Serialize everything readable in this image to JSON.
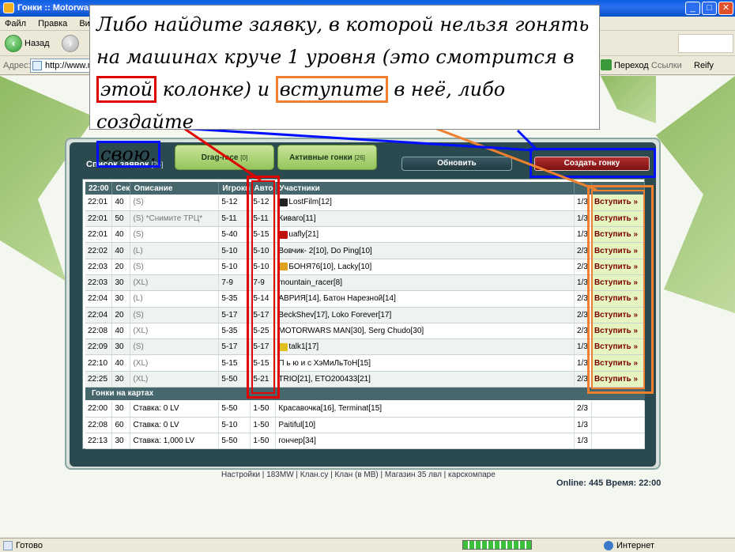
{
  "window": {
    "title": "Гонки :: Motorwar"
  },
  "menu": [
    "Файл",
    "Правка",
    "Вид"
  ],
  "toolbar": {
    "back_label": "Назад",
    "go_label": "Переход",
    "links_label": "Ссылки",
    "reify_label": "Reify"
  },
  "address": {
    "label": "Адрес:",
    "value": "http://www.mo"
  },
  "note": {
    "line1": "Либо найдите заявку, в которой нельзя гонять",
    "line2": "на машинах круче 1 уровня (это смотрится в",
    "this_column": "этой",
    "column_word": "колонке) и",
    "join_word": "вступите",
    "after_join": "в неё, либо создайте",
    "own": "свою."
  },
  "list": {
    "title": "Список заявок",
    "count": "[26]"
  },
  "tabs": [
    {
      "label": "Drag-race",
      "count": "[0]"
    },
    {
      "label": "Активные гонки",
      "count": "[26]"
    }
  ],
  "refresh_label": "Обновить",
  "create_label": "Создать гонку",
  "columns": [
    "22:00",
    "Сек",
    "Описание",
    "Игроки",
    "Авто",
    "Участники",
    "",
    ""
  ],
  "join_label": "Вступить »",
  "rows": [
    {
      "time": "22:01",
      "sec": "40",
      "desc": "(S)",
      "players": "5-12",
      "auto": "5-12",
      "participants": "LostFilm[12]",
      "count": "1/3",
      "badge": "#222"
    },
    {
      "time": "22:01",
      "sec": "50",
      "desc": "(S) *Снимите ТРЦ*",
      "players": "5-11",
      "auto": "5-11",
      "participants": "Киваго[11]",
      "count": "1/3",
      "badge": ""
    },
    {
      "time": "22:01",
      "sec": "40",
      "desc": "(S)",
      "players": "5-40",
      "auto": "5-15",
      "participants": "uafly[21]",
      "count": "1/3",
      "badge": "#c01010"
    },
    {
      "time": "22:02",
      "sec": "40",
      "desc": "(L)",
      "players": "5-10",
      "auto": "5-10",
      "participants": "Вовчик- 2[10], Do Ping[10]",
      "count": "2/3",
      "badge": ""
    },
    {
      "time": "22:03",
      "sec": "20",
      "desc": "(S)",
      "players": "5-10",
      "auto": "5-10",
      "participants": "БОНЯ76[10], Lacky[10]",
      "count": "2/3",
      "badge": "#e0a020"
    },
    {
      "time": "22:03",
      "sec": "30",
      "desc": "(XL)",
      "players": "7-9",
      "auto": "7-9",
      "participants": "mountain_racer[8]",
      "count": "1/3",
      "badge": ""
    },
    {
      "time": "22:04",
      "sec": "30",
      "desc": "(L)",
      "players": "5-35",
      "auto": "5-14",
      "participants": "АВРИЯ[14], Батон Нарезной[14]",
      "count": "2/3",
      "badge": ""
    },
    {
      "time": "22:04",
      "sec": "20",
      "desc": "(S)",
      "players": "5-17",
      "auto": "5-17",
      "participants": "BeckShev[17], Loko Forever[17]",
      "count": "2/3",
      "badge": ""
    },
    {
      "time": "22:08",
      "sec": "40",
      "desc": "(XL)",
      "players": "5-35",
      "auto": "5-25",
      "participants": "MOTORWARS MAN[30], Serg Chudo[30]",
      "count": "2/3",
      "badge": ""
    },
    {
      "time": "22:09",
      "sec": "30",
      "desc": "(S)",
      "players": "5-17",
      "auto": "5-17",
      "participants": "talk1[17]",
      "count": "1/3",
      "badge": "#e0c020"
    },
    {
      "time": "22:10",
      "sec": "40",
      "desc": "(XL)",
      "players": "5-15",
      "auto": "5-15",
      "participants": "П ь ю и с ХэМиЛьТоН[15]",
      "count": "1/3",
      "badge": ""
    },
    {
      "time": "22:25",
      "sec": "30",
      "desc": "(XL)",
      "players": "5-50",
      "auto": "5-21",
      "participants": "TRIO[21], ETO200433[21]",
      "count": "2/3",
      "badge": ""
    }
  ],
  "maps_title": "Гонки на картах",
  "map_rows": [
    {
      "time": "22:00",
      "sec": "30",
      "desc": "Ставка: 0 LV",
      "players": "5-50",
      "auto": "1-50",
      "participants": "Красавочка[16], Terminat[15]",
      "count": "2/3"
    },
    {
      "time": "22:08",
      "sec": "60",
      "desc": "Ставка: 0 LV",
      "players": "5-10",
      "auto": "1-50",
      "participants": "Paitiful[10]",
      "count": "1/3"
    },
    {
      "time": "22:13",
      "sec": "30",
      "desc": "Ставка: 1,000 LV",
      "players": "5-50",
      "auto": "1-50",
      "participants": "гончер[34]",
      "count": "1/3"
    }
  ],
  "footer": {
    "links": "Настройки | 183MW | Клан.су | Клан (в МВ) | Магазин 35 лвл | карскомпаре",
    "online": "Online: 445  Время: 22:00"
  },
  "status": {
    "left": "Готово",
    "right": "Интернет"
  },
  "colors": {
    "accent_red": "#e00000",
    "accent_orange": "#f08030",
    "accent_blue": "#0010ff"
  }
}
